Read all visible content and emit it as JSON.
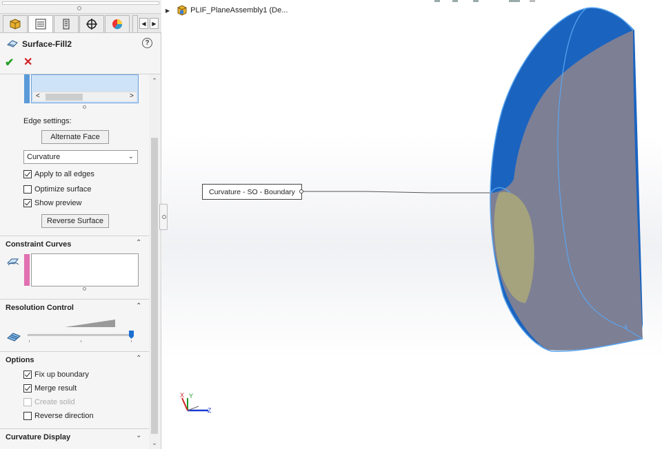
{
  "panel": {
    "tabs": [
      {
        "icon": "feature-manager-icon"
      },
      {
        "icon": "property-manager-icon",
        "active": true
      },
      {
        "icon": "configuration-manager-icon"
      },
      {
        "icon": "dimxpert-manager-icon"
      },
      {
        "icon": "display-manager-icon"
      }
    ],
    "feature_title": "Surface-Fill2",
    "help_label": "?",
    "ok_label": "✔",
    "cancel_label": "✕"
  },
  "patch_boundary": {
    "edge_settings_label": "Edge settings:",
    "alternate_face_label": "Alternate Face",
    "curvature_dropdown": "Curvature",
    "apply_all_edges": {
      "label": "Apply to all edges",
      "checked": true
    },
    "optimize_surface": {
      "label": "Optimize surface",
      "checked": false
    },
    "show_preview": {
      "label": "Show preview",
      "checked": true
    },
    "reverse_surface_label": "Reverse Surface"
  },
  "constraint_curves": {
    "title": "Constraint Curves"
  },
  "resolution_control": {
    "title": "Resolution Control",
    "slider_value": 1.0
  },
  "options": {
    "title": "Options",
    "fix_up_boundary": {
      "label": "Fix up boundary",
      "checked": true
    },
    "merge_result": {
      "label": "Merge result",
      "checked": true
    },
    "create_solid": {
      "label": "Create solid",
      "checked": false,
      "disabled": true
    },
    "reverse_direction": {
      "label": "Reverse direction",
      "checked": false
    }
  },
  "curvature_display": {
    "title": "Curvature Display"
  },
  "viewport": {
    "tree_item": "PLIF_PlaneAssembly1  (De...",
    "callout_text": "Curvature - SO - Boundary",
    "triad_labels": {
      "x": "X",
      "y": "Y",
      "z": "Z"
    }
  },
  "colors": {
    "surface_blue": "#1a64c0",
    "surface_gray": "#7d7f95",
    "preview_yellow": "#a9a77a",
    "edge_highlight": "#5aa6f0",
    "constraint_flag": "#e070b0"
  }
}
